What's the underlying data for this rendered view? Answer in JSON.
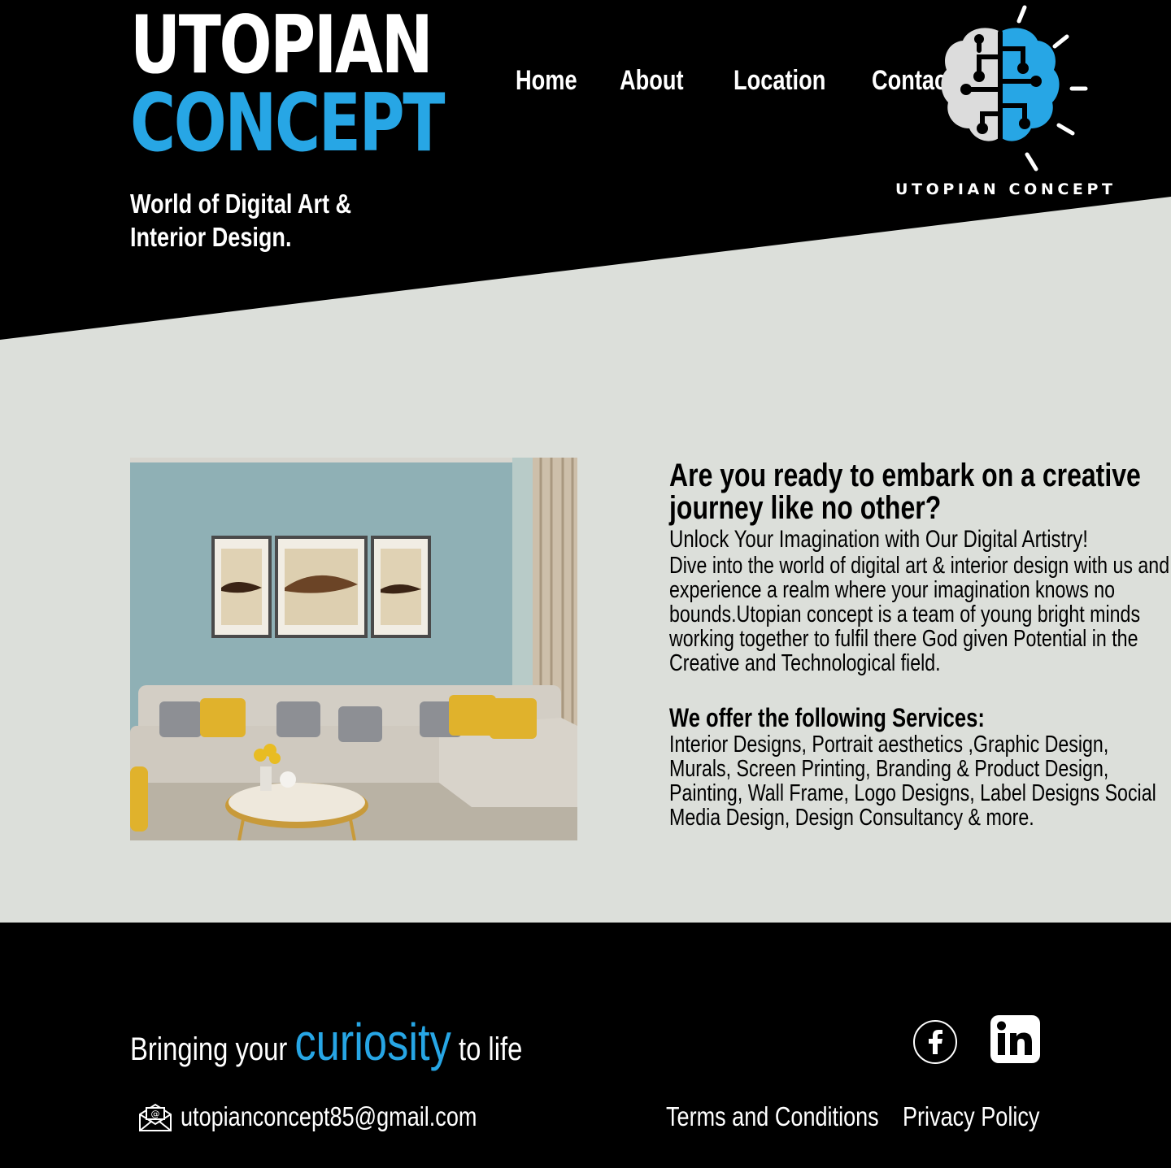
{
  "header": {
    "brand_line1": "UTOPIAN",
    "brand_line2": "CONCEPT",
    "tagline": "World of Digital Art & Interior Design.",
    "nav": [
      "Home",
      "About",
      "Location",
      "Contact"
    ],
    "logo_text": "UTOPIAN CONCEPT"
  },
  "main": {
    "headline": "Are you ready to embark on a creative journey like no other?",
    "subheadline": "Unlock Your Imagination with Our Digital Artistry!",
    "body": "Dive into the world of digital art & interior design with us and experience a realm where your imagination knows no bounds.Utopian concept is a team of young bright minds working together to fulfil there God given Potential in the Creative and Technological field.",
    "services_title": "We offer the following Services:",
    "services_body": "Interior Designs, Portrait aesthetics ,Graphic Design, Murals, Screen Printing, Branding & Product Design, Painting, Wall Frame, Logo Designs, Label Designs Social Media Design, Design Consultancy & more."
  },
  "footer": {
    "slogan_before": "Bringing your ",
    "slogan_accent": "curiosity",
    "slogan_after": " to life",
    "email": "utopianconcept85@gmail.com",
    "terms": "Terms and Conditions",
    "privacy": "Privacy Policy"
  },
  "colors": {
    "accent": "#27a6e5",
    "header_bg": "#000000",
    "page_bg": "#dcdfda"
  },
  "icons": [
    "brain-logo-icon",
    "facebook-icon",
    "linkedin-icon",
    "email-icon"
  ]
}
